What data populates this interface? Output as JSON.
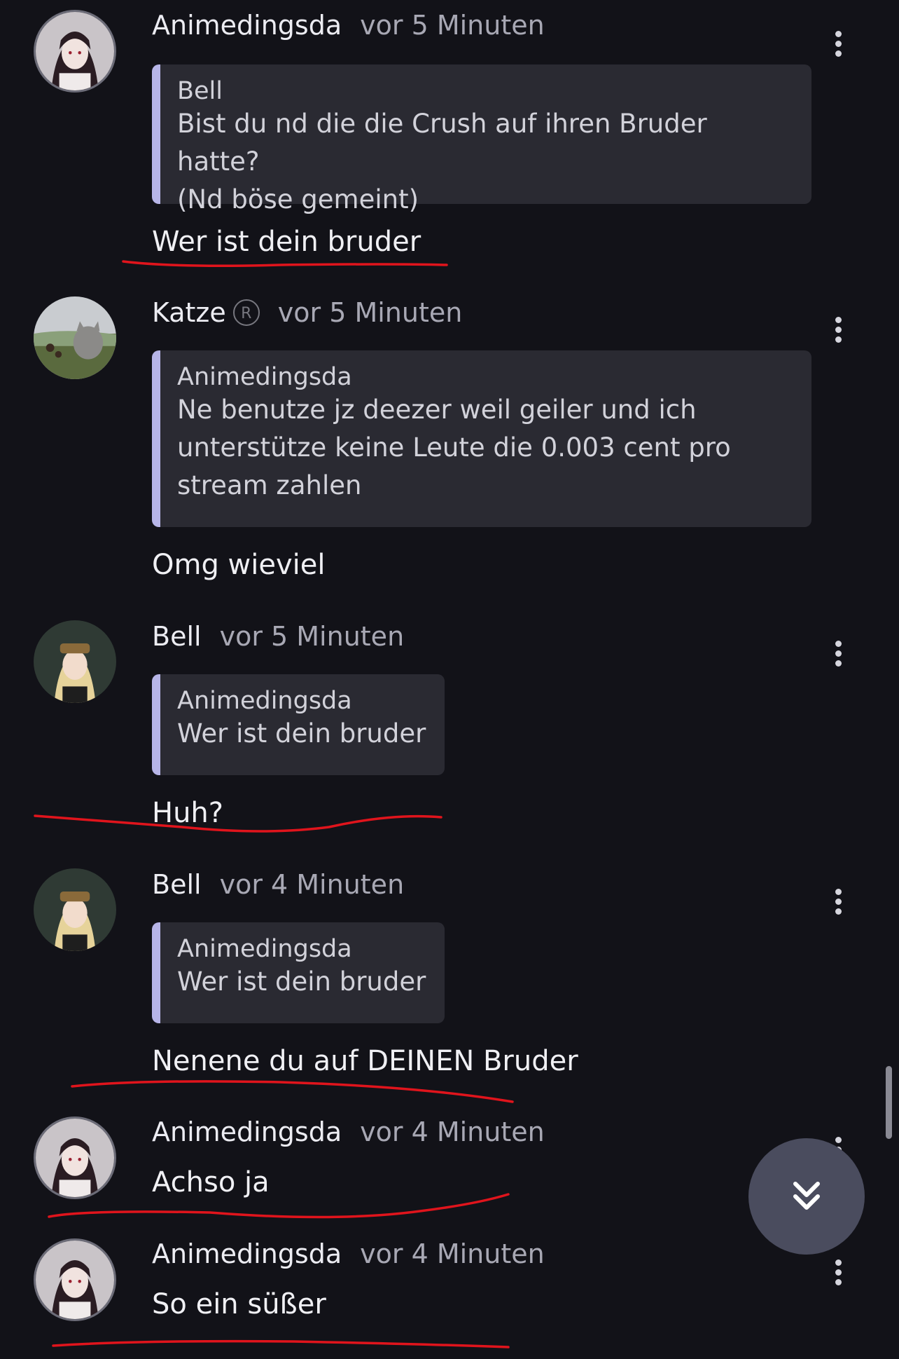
{
  "messages": [
    {
      "author": "Animedingsda",
      "time": "vor 5 Minuten",
      "quote_author": "Bell",
      "quote_lines": [
        "Bist du nd die die Crush auf ihren Bruder hatte?",
        "(Nd böse gemeint)"
      ],
      "text": "Wer ist dein bruder"
    },
    {
      "author": "Katze",
      "badge": "R",
      "time": "vor 5 Minuten",
      "quote_author": "Animedingsda",
      "quote_lines": [
        "Ne benutze jz deezer weil geiler und ich",
        "unterstütze keine Leute die 0.003 cent pro",
        "stream zahlen"
      ],
      "text": "Omg wieviel"
    },
    {
      "author": "Bell",
      "time": "vor 5 Minuten",
      "quote_author": "Animedingsda",
      "quote_lines": [
        "Wer ist dein bruder"
      ],
      "text": "Huh?"
    },
    {
      "author": "Bell",
      "time": "vor 4 Minuten",
      "quote_author": "Animedingsda",
      "quote_lines": [
        "Wer ist dein bruder"
      ],
      "text": "Nenene du auf DEINEN Bruder"
    },
    {
      "author": "Animedingsda",
      "time": "vor 4 Minuten",
      "text": "Achso ja"
    },
    {
      "author": "Animedingsda",
      "time": "vor 4 Minuten",
      "text": "So ein süßer"
    }
  ],
  "icons": {
    "more": "more-vert-icon",
    "scroll_down": "double-chevron-down-icon",
    "registered": "registered-icon"
  },
  "colors": {
    "background": "#121218",
    "quote_bg": "#2a2a32",
    "quote_bar": "#b7b5e8",
    "annotation": "#e0141c",
    "scroll_button": "#4a4c5e"
  }
}
